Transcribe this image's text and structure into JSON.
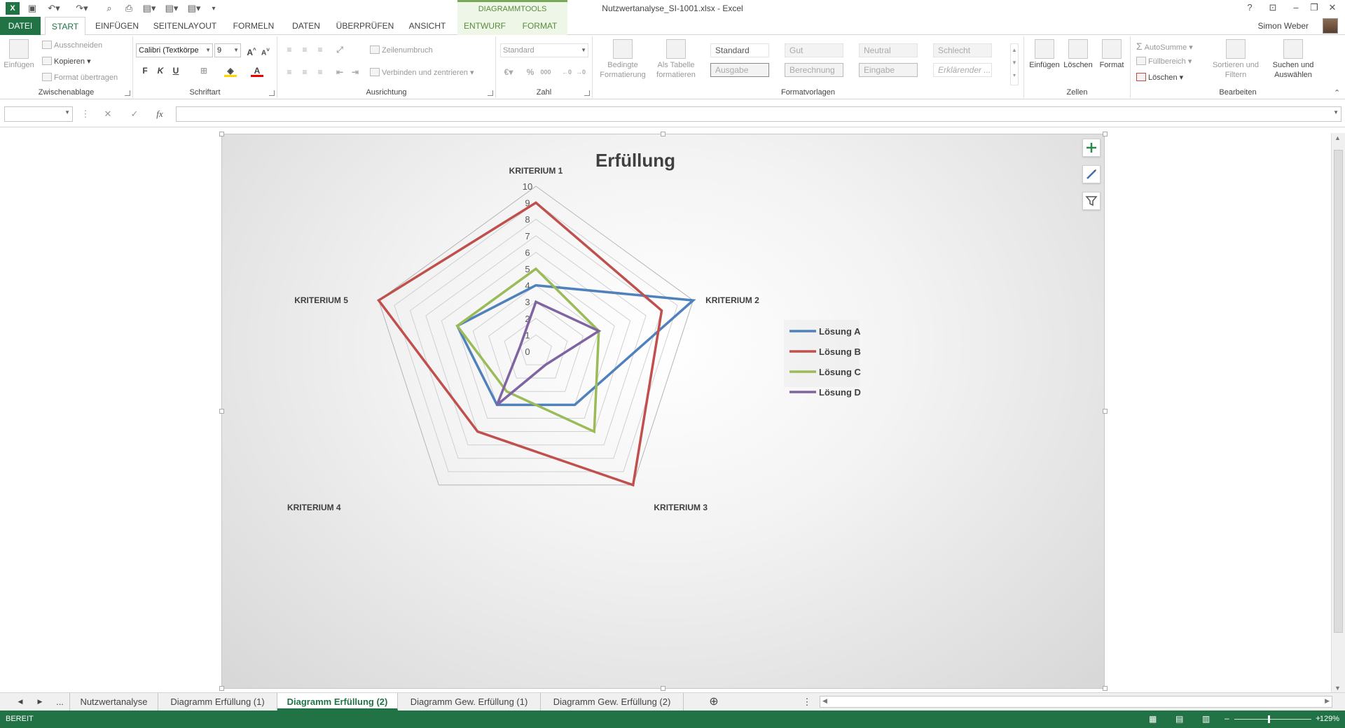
{
  "window": {
    "title": "Nutzwertanalyse_SI-1001.xlsx - Excel",
    "context_header": "DIAGRAMMTOOLS",
    "user": "Simon Weber",
    "help": "?"
  },
  "tabs": [
    "DATEI",
    "START",
    "EINFÜGEN",
    "SEITENLAYOUT",
    "FORMELN",
    "DATEN",
    "ÜBERPRÜFEN",
    "ANSICHT",
    "ENTWURF",
    "FORMAT"
  ],
  "ribbon": {
    "clipboard": {
      "paste": "Einfügen",
      "cut": "Ausschneiden",
      "copy": "Kopieren",
      "format_painter": "Format übertragen",
      "label": "Zwischenablage"
    },
    "font": {
      "font_name": "Calibri (Textkörpe",
      "font_size": "9",
      "bold": "F",
      "italic": "K",
      "underline": "U",
      "label": "Schriftart"
    },
    "alignment": {
      "wrap": "Zeilenumbruch",
      "merge": "Verbinden und zentrieren",
      "label": "Ausrichtung"
    },
    "number": {
      "format": "Standard",
      "percent": "%",
      "thousands": "000",
      "label": "Zahl"
    },
    "styles": {
      "conditional": "Bedingte Formatierung",
      "as_table": "Als Tabelle formatieren",
      "cells": [
        "Standard",
        "Gut",
        "Neutral",
        "Schlecht",
        "Ausgabe",
        "Berechnung",
        "Eingabe",
        "Erklärender ..."
      ],
      "label": "Formatvorlagen"
    },
    "cells": {
      "insert": "Einfügen",
      "delete": "Löschen",
      "format": "Format",
      "label": "Zellen"
    },
    "editing": {
      "autosum": "AutoSumme",
      "fill": "Füllbereich",
      "clear": "Löschen",
      "sort": "Sortieren und Filtern",
      "find": "Suchen und Auswählen",
      "label": "Bearbeiten"
    }
  },
  "formula_bar": {
    "fx": "fx"
  },
  "chart_data": {
    "type": "radar",
    "title": "Erfüllung",
    "categories": [
      "KRITERIUM 1",
      "KRITERIUM 2",
      "KRITERIUM 3",
      "KRITERIUM 4",
      "KRITERIUM 5"
    ],
    "rlim": [
      0,
      10
    ],
    "ticks": [
      "0",
      "1",
      "2",
      "3",
      "4",
      "5",
      "6",
      "7",
      "8",
      "9",
      "10"
    ],
    "legend_position": "right",
    "series": [
      {
        "name": "Lösung A",
        "color": "#4f81bd",
        "values": [
          4,
          10,
          4,
          4,
          5
        ]
      },
      {
        "name": "Lösung B",
        "color": "#c0504d",
        "values": [
          9,
          8,
          10,
          6,
          10
        ]
      },
      {
        "name": "Lösung C",
        "color": "#9bbb59",
        "values": [
          5,
          4,
          6,
          3,
          5
        ]
      },
      {
        "name": "Lösung D",
        "color": "#8064a2",
        "values": [
          3,
          4,
          1,
          4,
          1
        ]
      }
    ]
  },
  "sheets": [
    "...",
    "Nutzwertanalyse",
    "Diagramm Erfüllung (1)",
    "Diagramm Erfüllung (2)",
    "Diagramm Gew. Erfüllung (1)",
    "Diagramm Gew. Erfüllung (2)"
  ],
  "status": {
    "mode": "BEREIT",
    "zoom": "129%"
  }
}
